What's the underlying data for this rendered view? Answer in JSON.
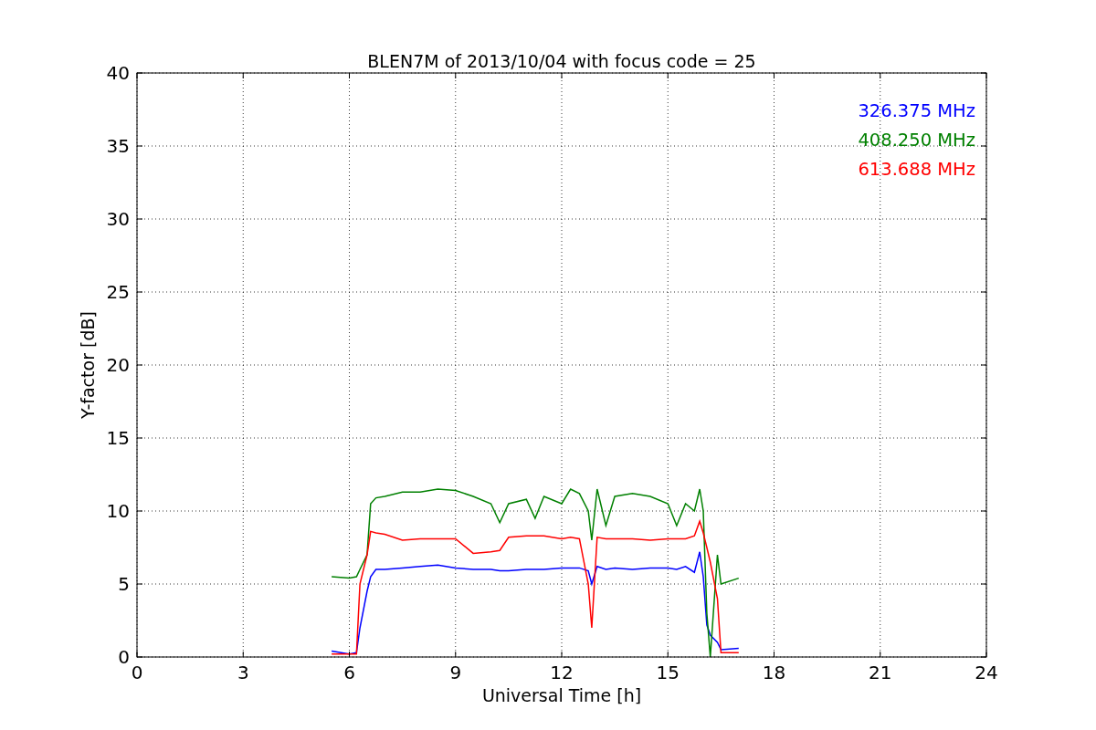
{
  "figure": {
    "chart_data": {
      "type": "line",
      "title": "BLEN7M of 2013/10/04 with focus code = 25",
      "xlabel": "Universal Time [h]",
      "ylabel": "Y-factor [dB]",
      "grid": true,
      "xlim": [
        0,
        24
      ],
      "ylim": [
        0,
        40
      ],
      "xticks": [
        0,
        3,
        6,
        9,
        12,
        15,
        18,
        21,
        24
      ],
      "yticks": [
        0,
        5,
        10,
        15,
        20,
        25,
        30,
        35,
        40
      ],
      "x": [
        5.5,
        6.0,
        6.2,
        6.3,
        6.5,
        6.6,
        6.75,
        7,
        7.5,
        8,
        8.5,
        9,
        9.5,
        10,
        10.25,
        10.5,
        11,
        11.25,
        11.5,
        12,
        12.25,
        12.5,
        12.75,
        12.85,
        13,
        13.25,
        13.5,
        14,
        14.5,
        15,
        15.25,
        15.5,
        15.75,
        15.9,
        16.0,
        16.1,
        16.2,
        16.4,
        16.5,
        17
      ],
      "series": [
        {
          "name": "326.375 MHz",
          "color": "#0000ff",
          "values": [
            0.4,
            0.2,
            0.3,
            2,
            4.5,
            5.5,
            6,
            6,
            6.1,
            6.2,
            6.3,
            6.1,
            6.0,
            6.0,
            5.9,
            5.9,
            6.0,
            6.0,
            6.0,
            6.1,
            6.1,
            6.1,
            5.9,
            5.0,
            6.2,
            6.0,
            6.1,
            6.0,
            6.1,
            6.1,
            6.0,
            6.2,
            5.8,
            7.2,
            5.5,
            2.2,
            1.5,
            1.0,
            0.5,
            0.6
          ]
        },
        {
          "name": "408.250 MHz",
          "color": "#008000",
          "values": [
            5.5,
            5.4,
            5.5,
            6,
            7,
            10.5,
            10.9,
            11,
            11.3,
            11.3,
            11.5,
            11.4,
            11.0,
            10.5,
            9.2,
            10.5,
            10.8,
            9.5,
            11,
            10.5,
            11.5,
            11.2,
            10,
            8,
            11.5,
            9,
            11,
            11.2,
            11,
            10.5,
            9,
            10.5,
            10,
            11.5,
            10,
            3,
            0,
            7,
            5,
            5.4
          ]
        },
        {
          "name": "613.688 MHz",
          "color": "#ff0000",
          "values": [
            0.2,
            0.2,
            0.2,
            5,
            7,
            8.6,
            8.5,
            8.4,
            8.0,
            8.1,
            8.1,
            8.1,
            7.1,
            7.2,
            7.3,
            8.2,
            8.3,
            8.3,
            8.3,
            8.1,
            8.2,
            8.1,
            5,
            2,
            8.2,
            8.1,
            8.1,
            8.1,
            8.0,
            8.1,
            8.1,
            8.1,
            8.3,
            9.3,
            8.5,
            7.5,
            6.5,
            4,
            0.3,
            0.3
          ]
        }
      ]
    }
  }
}
